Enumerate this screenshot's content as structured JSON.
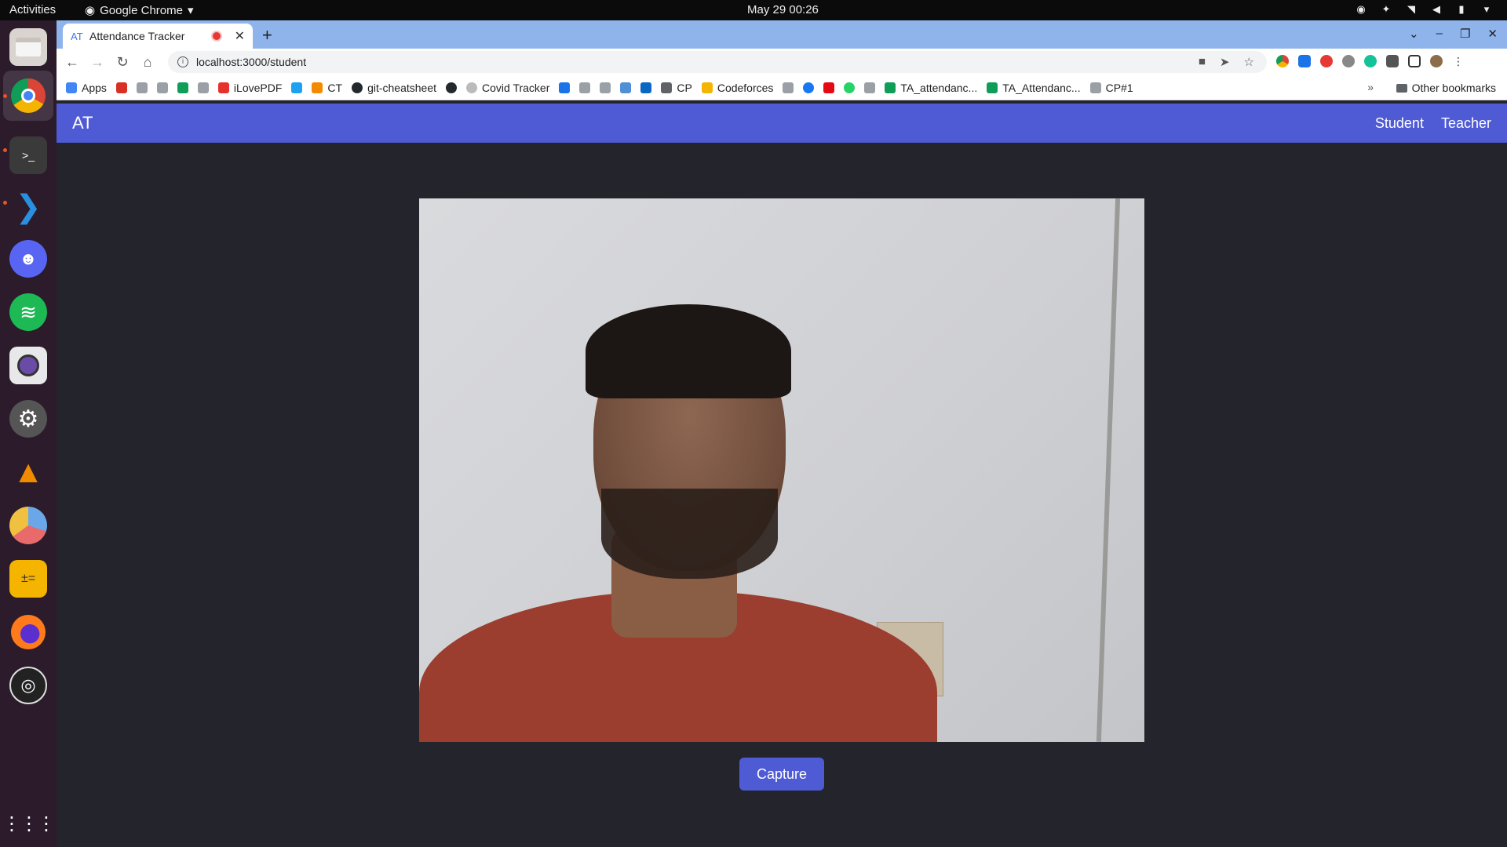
{
  "system": {
    "activities": "Activities",
    "app_name": "Google Chrome",
    "clock": "May 29  00:26"
  },
  "browser": {
    "tab_title": "Attendance Tracker",
    "url": "localhost:3000/student",
    "bookmarks": [
      {
        "label": "Apps",
        "icon": "apps-grid-icon"
      },
      {
        "label": "",
        "icon": "gmail-icon"
      },
      {
        "label": "",
        "icon": "bookmark-icon"
      },
      {
        "label": "",
        "icon": "bookmark-icon"
      },
      {
        "label": "",
        "icon": "drive-icon"
      },
      {
        "label": "",
        "icon": "bookmark-icon"
      },
      {
        "label": "iLovePDF",
        "icon": "ilovepdf-icon"
      },
      {
        "label": "",
        "icon": "twitter-icon"
      },
      {
        "label": "CT",
        "icon": "ct-icon"
      },
      {
        "label": "git-cheatsheet",
        "icon": "github-icon"
      },
      {
        "label": "",
        "icon": "github-icon"
      },
      {
        "label": "Covid Tracker",
        "icon": "covid-icon"
      },
      {
        "label": "",
        "icon": "play-icon"
      },
      {
        "label": "",
        "icon": "bookmark-icon"
      },
      {
        "label": "",
        "icon": "bookmark-icon"
      },
      {
        "label": "",
        "icon": "chart-icon"
      },
      {
        "label": "",
        "icon": "linkedin-icon"
      },
      {
        "label": "CP",
        "icon": "folder-icon"
      },
      {
        "label": "Codeforces",
        "icon": "codeforces-icon"
      },
      {
        "label": "",
        "icon": "bookmark-icon"
      },
      {
        "label": "",
        "icon": "facebook-icon"
      },
      {
        "label": "",
        "icon": "netflix-icon"
      },
      {
        "label": "",
        "icon": "whatsapp-icon"
      },
      {
        "label": "",
        "icon": "bookmark-icon"
      },
      {
        "label": "TA_attendanc...",
        "icon": "sheets-icon"
      },
      {
        "label": "TA_Attendanc...",
        "icon": "sheets-icon"
      },
      {
        "label": "CP#1",
        "icon": "bookmark-icon"
      }
    ],
    "other_bookmarks": "Other bookmarks"
  },
  "app": {
    "brand": "AT",
    "nav": [
      "Student",
      "Teacher"
    ],
    "capture_label": "Capture"
  },
  "colors": {
    "nav_bg": "#4f5bd5",
    "page_bg": "#24242c",
    "button_bg": "#4f5bd5"
  }
}
